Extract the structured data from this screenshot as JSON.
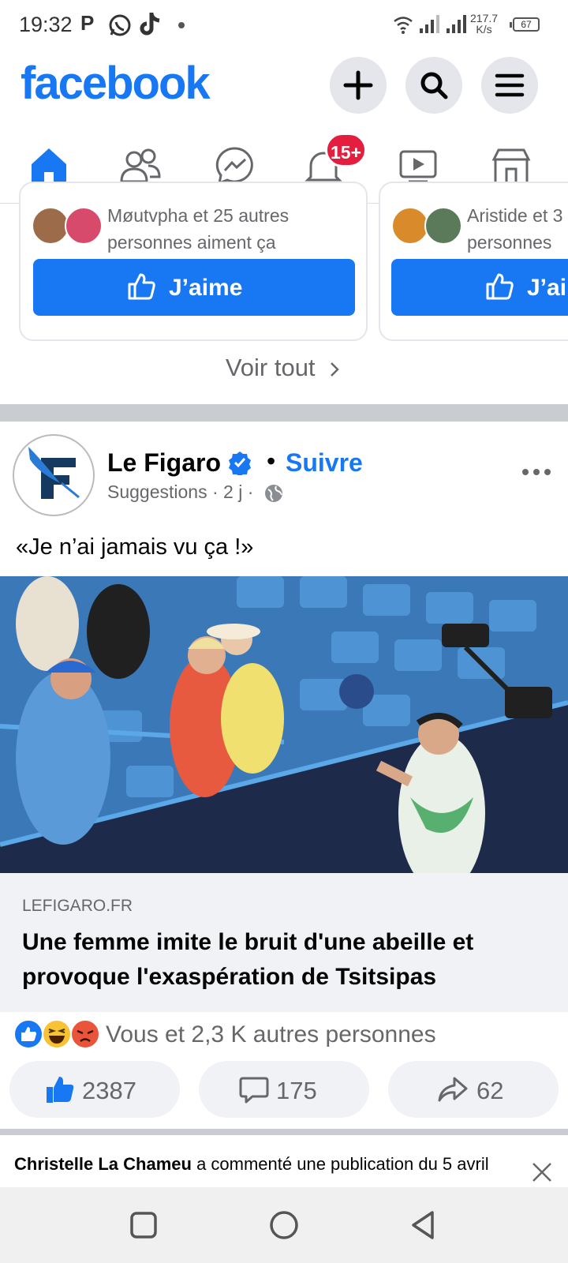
{
  "status_bar": {
    "time": "19:32",
    "icons": [
      "parking-icon",
      "whatsapp-icon",
      "tiktok-icon",
      "dot-icon",
      "wifi-icon",
      "signal-icon",
      "signal-icon"
    ],
    "net_speed_value": "217.7",
    "net_speed_unit": "K/s",
    "battery": "67"
  },
  "header": {
    "logo": "facebook",
    "buttons": [
      "add-icon",
      "search-icon",
      "menu-icon"
    ],
    "brand_color": "#1877f2"
  },
  "nav": {
    "tabs": [
      "home-icon",
      "friends-icon",
      "messenger-icon",
      "notifications-icon",
      "video-icon",
      "marketplace-icon"
    ],
    "notification_badge": "15+"
  },
  "suggestions": {
    "cards": [
      {
        "likes_text_1": "Møutvpha et 25 autres",
        "likes_text_2": "personnes aiment ça",
        "button": "J’aime"
      },
      {
        "likes_text_1": "Aristide et 3",
        "likes_text_2": "personnes",
        "button": "J’ai"
      }
    ],
    "see_all": "Voir tout"
  },
  "post": {
    "author": "Le Figaro",
    "follow": "Suivre",
    "separator": "•",
    "meta": "Suggestions · 2 j ·",
    "text": "«Je n’ai jamais vu ça !»",
    "link": {
      "domain": "LEFIGARO.FR",
      "headline": "Une femme imite le bruit d'une abeille et provoque l'exaspération de Tsitsipas"
    },
    "reactions_text": "Vous et 2,3 K autres personnes",
    "like_count": "2387",
    "comment_count": "175",
    "share_count": "62"
  },
  "notification": {
    "name": "Christelle La Chameu",
    "text": " a commenté une publication du 5 avril"
  }
}
